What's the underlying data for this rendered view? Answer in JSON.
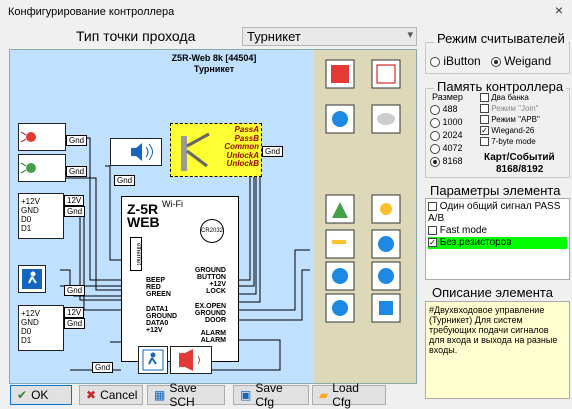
{
  "window": {
    "title": "Конфигурирование контроллера",
    "close": "×"
  },
  "passage": {
    "label": "Тип точки прохода",
    "value": "Турникет"
  },
  "diagram": {
    "header_line1": "Z5R-Web 8k [44504]",
    "header_line2": "Турникет",
    "gnd": "Gnd",
    "v12": "12V",
    "turnstile_terms": [
      "PassA",
      "PassB",
      "Common",
      "UnlockA",
      "UnlockB"
    ],
    "reader_terms": [
      "+12V",
      "GND",
      "D0",
      "D1"
    ],
    "controller_name_1": "Z-5R",
    "controller_name_2": "WEB",
    "wifi": "Wi-Fi",
    "battery": "CR2032",
    "ethernet": "ethernet",
    "left_terms": [
      "BEEP",
      "RED",
      "GREEN"
    ],
    "left_terms2": [
      "DATA1",
      "GROUND",
      "DATA0",
      "+12V"
    ],
    "right_terms": [
      "GROUND",
      "BUTTON",
      "+12V",
      "LOCK"
    ],
    "right_terms2": [
      "EX.OPEN",
      "GROUND",
      "DOOR"
    ],
    "right_terms3": [
      "ALARM",
      "ALARM"
    ],
    "pane_icons": [
      "door-icon",
      "exit-icon",
      "beacon-icon",
      "camera-icon",
      "bell-icon",
      "shield-icon",
      "key-icon",
      "number-1-icon",
      "number-2-icon",
      "number-3-icon",
      "number-4-icon",
      "info-icon"
    ],
    "colors": {
      "background": "#bfe0ff",
      "turnstile": "#ffff33",
      "pane": "#ddd9b8"
    }
  },
  "reader_mode": {
    "title": "Режим считывателей",
    "opt1": "iButton",
    "opt2": "Weigand",
    "selected": "Weigand"
  },
  "memory": {
    "title": "Память контроллера",
    "size_label": "Размер",
    "sizes": [
      "488",
      "1000",
      "2024",
      "4072",
      "8168"
    ],
    "selected": "8168",
    "checks": [
      "Два банка",
      "Режим \"Join\"",
      "Режим \"APB\"",
      "Wiegand-26",
      "7-byte mode"
    ],
    "checked": [
      "Wiegand-26"
    ],
    "cards_label": "Карт/Событий",
    "cards_value": "8168/8192"
  },
  "params": {
    "title": "Параметры элемента",
    "items": [
      "Один общий сигнал PASS A/B",
      "Fast mode",
      "Без резисторов"
    ],
    "selected": "Без резисторов"
  },
  "description": {
    "title": "Описание элемента",
    "text": "#Двухвходовое управление (Турникет) Для систем требующих подачи сигналов для входа и выхода на разные входы."
  },
  "buttons": {
    "ok": "OK",
    "cancel": "Cancel",
    "save_sch": "Save SCH",
    "save_cfg": "Save Cfg",
    "load_cfg": "Load Cfg"
  }
}
